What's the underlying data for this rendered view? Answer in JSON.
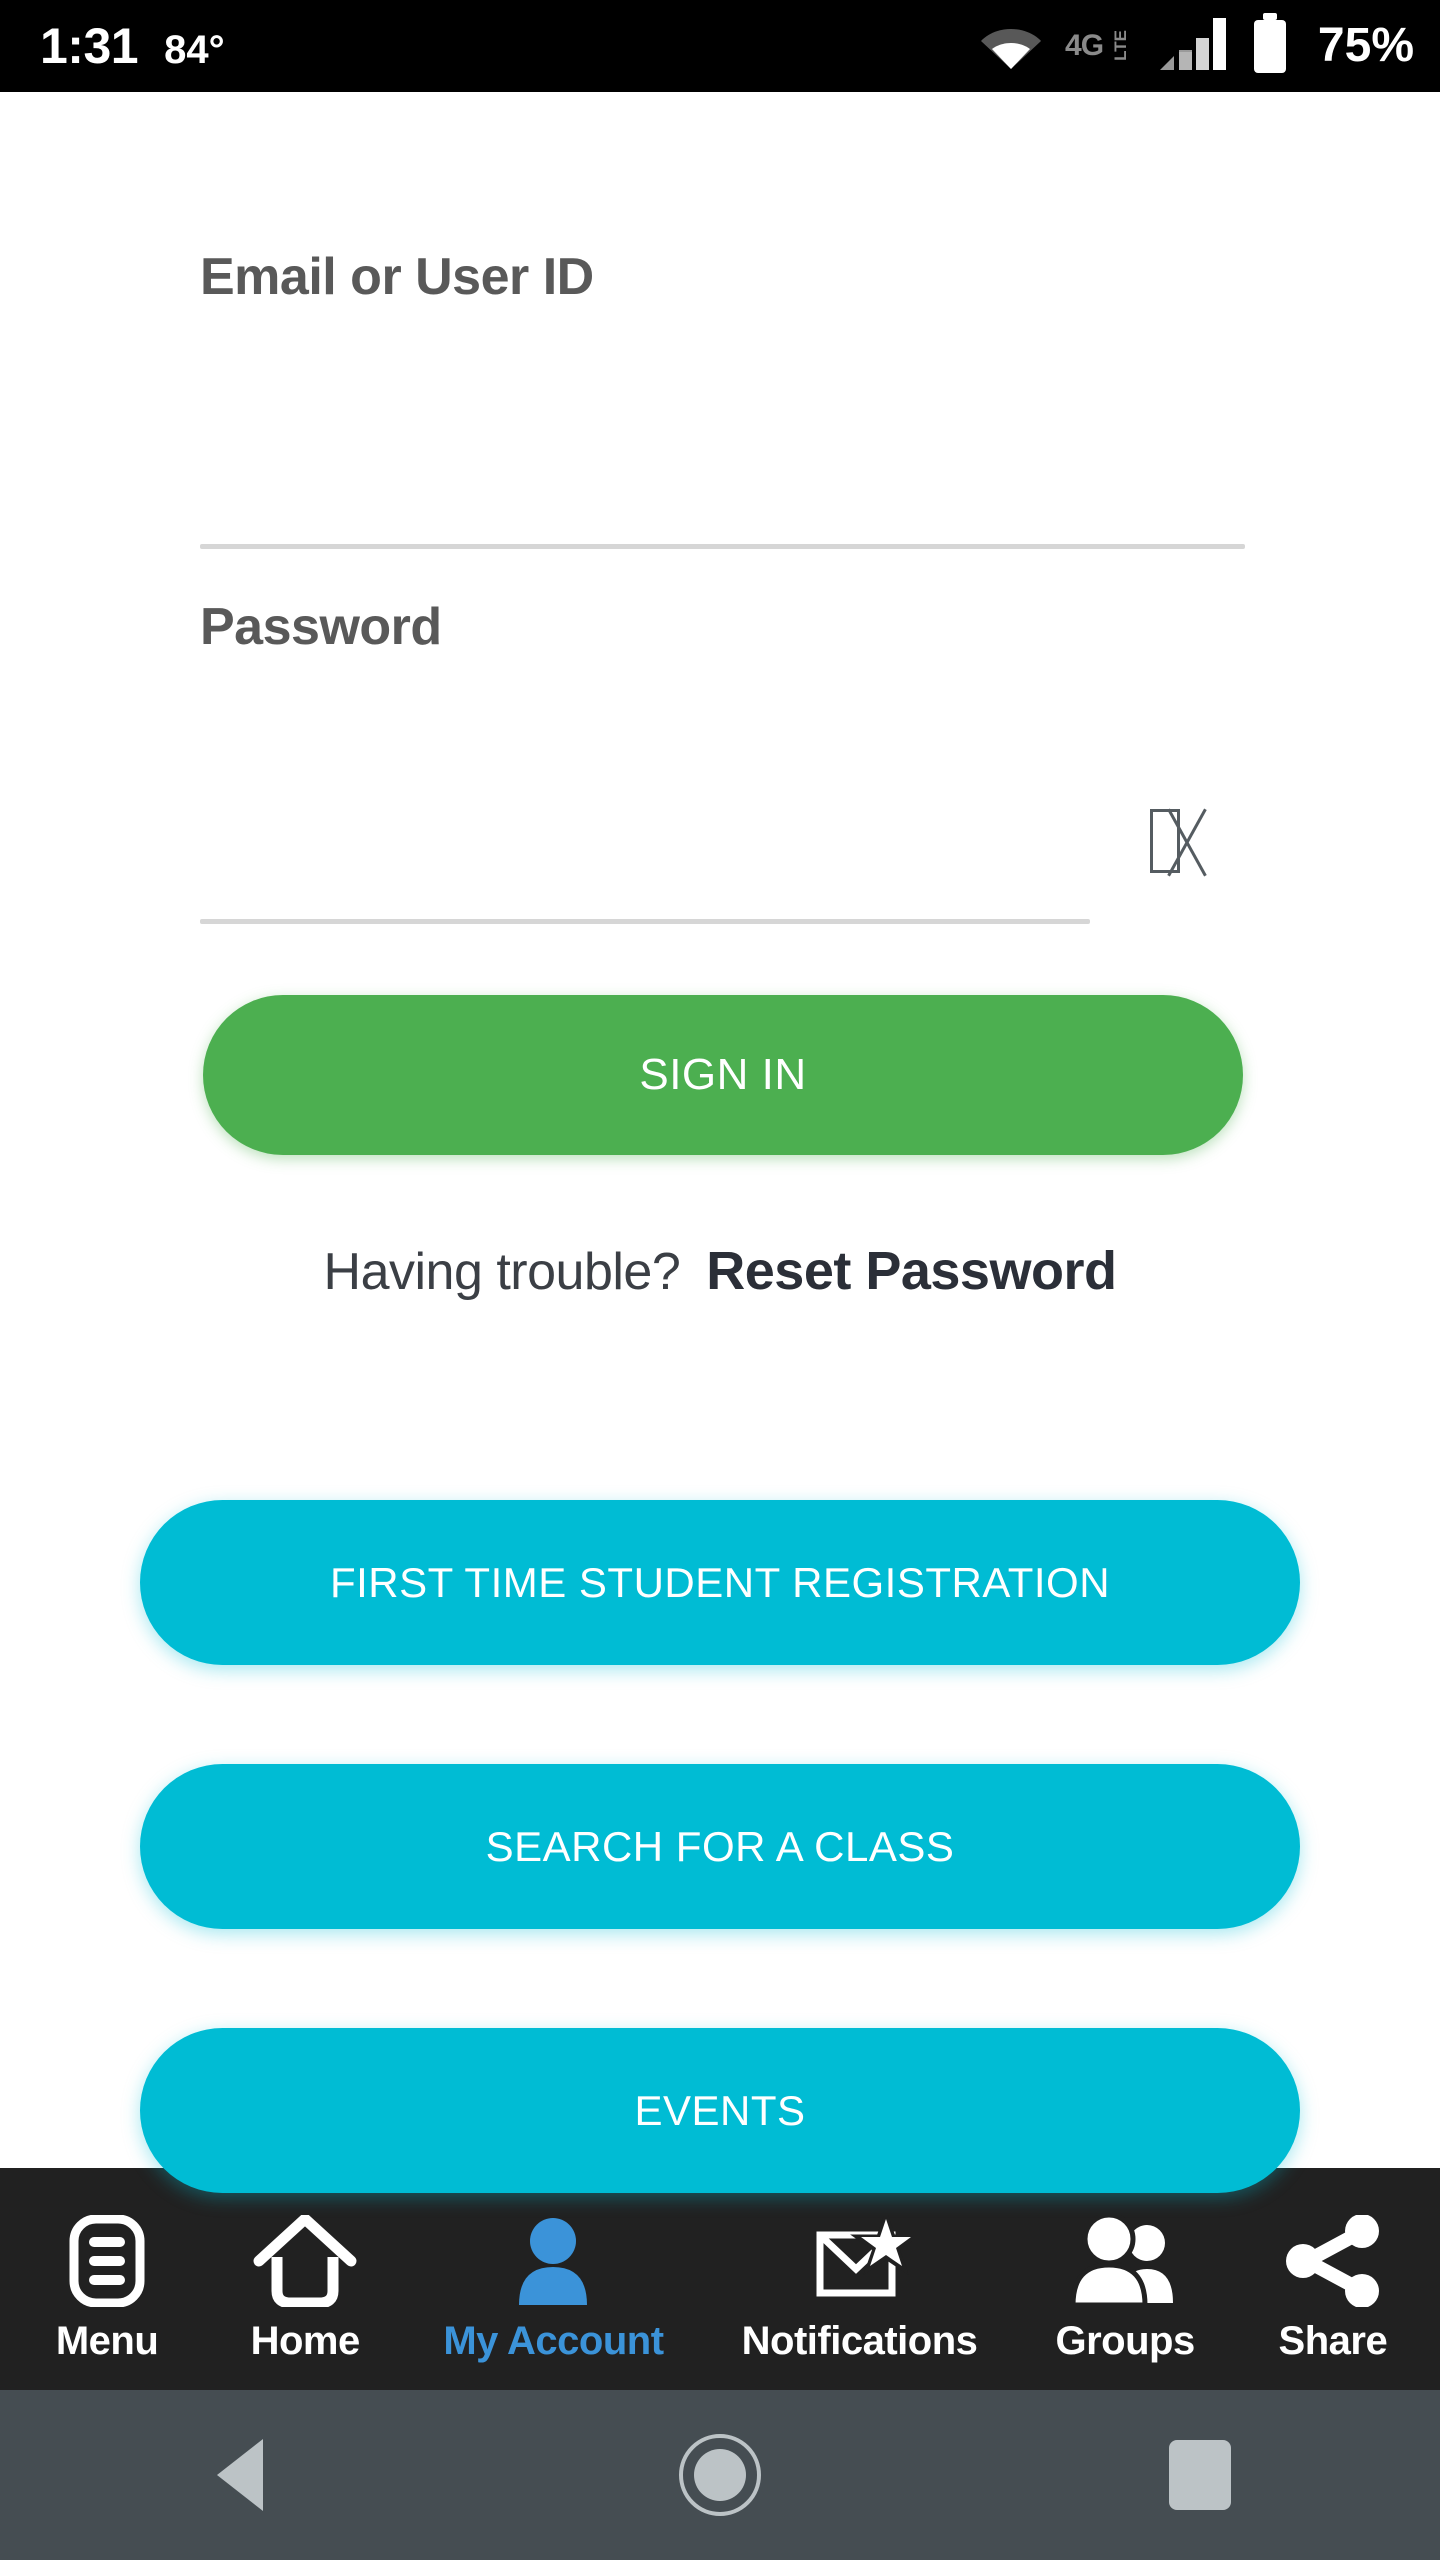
{
  "status_bar": {
    "time": "1:31",
    "temperature": "84°",
    "network_type": "4G",
    "network_suffix": "LTE",
    "battery_percent": "75%",
    "icons": [
      "wifi-icon",
      "signal-bars-icon",
      "battery-icon"
    ],
    "background_color": "#000000"
  },
  "form": {
    "email": {
      "label": "Email or User ID",
      "value": "",
      "placeholder": ""
    },
    "password": {
      "label": "Password",
      "value": "",
      "placeholder": "",
      "toggle_icon": "show-password-icon-missing-glyph"
    }
  },
  "primary_action": {
    "sign_in_label": "SIGN IN",
    "color": "#4CAF50"
  },
  "help_row": {
    "question": "Having trouble?",
    "reset_link": "Reset Password"
  },
  "secondary_actions": {
    "color": "#00BCD4",
    "buttons": [
      {
        "label": "FIRST TIME STUDENT REGISTRATION",
        "name": "first-time-student-registration-button"
      },
      {
        "label": "SEARCH FOR A CLASS",
        "name": "search-for-a-class-button"
      },
      {
        "label": "EVENTS",
        "name": "events-button"
      }
    ]
  },
  "bottom_nav": {
    "background_color": "#212121",
    "active_color": "#3B93D9",
    "items": [
      {
        "label": "Menu",
        "icon": "menu-list-icon",
        "active": false
      },
      {
        "label": "Home",
        "icon": "home-icon",
        "active": false
      },
      {
        "label": "My Account",
        "icon": "person-icon",
        "active": true
      },
      {
        "label": "Notifications",
        "icon": "envelope-star-icon",
        "active": false
      },
      {
        "label": "Groups",
        "icon": "people-group-icon",
        "active": false
      },
      {
        "label": "Share",
        "icon": "share-nodes-icon",
        "active": false
      }
    ]
  },
  "system_nav": {
    "background_color": "#454D52",
    "buttons": [
      {
        "name": "back-button",
        "icon": "triangle-back-icon"
      },
      {
        "name": "home-button",
        "icon": "circle-home-icon"
      },
      {
        "name": "recents-button",
        "icon": "square-recents-icon"
      }
    ]
  }
}
